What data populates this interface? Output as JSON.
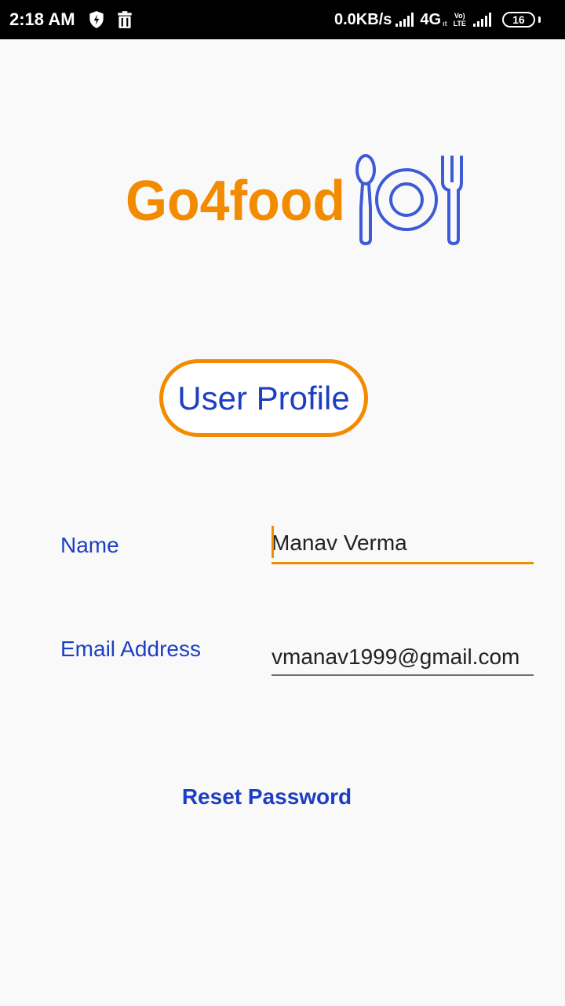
{
  "status_bar": {
    "time": "2:18 AM",
    "speed": "0.0KB/s",
    "network": "4G",
    "network_sub": "ıt",
    "volte_top": "Vo)",
    "volte_bottom": "LTE",
    "battery": "16",
    "icons": [
      "shield-bolt-icon",
      "trash-icon",
      "signal-icon",
      "signal-icon",
      "battery-icon"
    ]
  },
  "logo": {
    "text": "Go4food",
    "brand_color": "#f28b00",
    "icon_color": "#3d5bd6",
    "icon": "spoon-plate-fork-icon"
  },
  "page": {
    "title": "User Profile"
  },
  "form": {
    "name_label": "Name",
    "name_value": "Manav Verma",
    "email_label": "Email Address",
    "email_value": "vmanav1999@gmail.com"
  },
  "actions": {
    "reset_password": "Reset Password"
  },
  "colors": {
    "accent": "#f28b00",
    "primary_text": "#1e3ec2",
    "background": "#f9f9f9"
  }
}
